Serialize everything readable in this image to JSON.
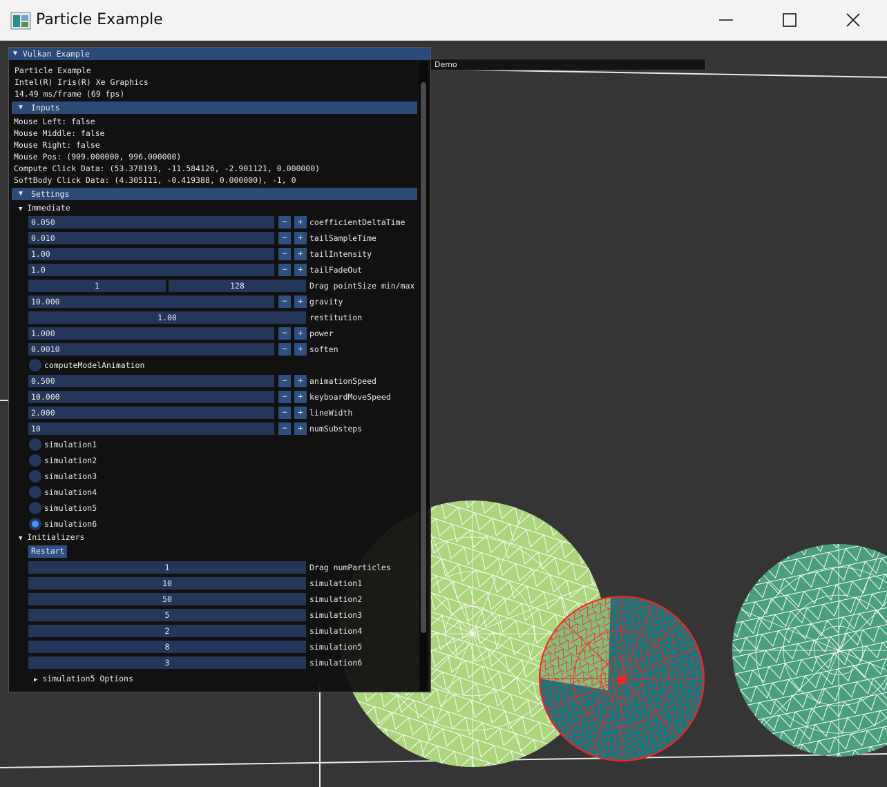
{
  "window": {
    "title": "Particle Example"
  },
  "demo_window": {
    "label": "Demo"
  },
  "panel": {
    "title": "Vulkan Example",
    "info": [
      "Particle Example",
      "Intel(R) Iris(R) Xe Graphics",
      "14.49 ms/frame (69 fps)"
    ],
    "inputs_header": "Inputs",
    "inputs": [
      "Mouse Left: false",
      "Mouse Middle: false",
      "Mouse Right: false",
      "Mouse Pos: (909.000000, 996.000000)",
      "Compute Click Data: (53.378193, -11.584126, -2.901121, 0.000000)",
      "SoftBody Click Data: (4.305111, -0.419388, 0.000000), -1, 0"
    ],
    "settings_header": "Settings",
    "immediate_label": "Immediate",
    "controls": {
      "coefficientDeltaTime": {
        "value": "0.050",
        "label": "coefficientDeltaTime"
      },
      "tailSampleTime": {
        "value": "0.010",
        "label": "tailSampleTime"
      },
      "tailIntensity": {
        "value": "1.00",
        "label": "tailIntensity"
      },
      "tailFadeOut": {
        "value": "1.0",
        "label": "tailFadeOut"
      },
      "pointSize": {
        "min": "1",
        "max": "128",
        "label": "Drag pointSize min/max"
      },
      "gravity": {
        "value": "10.000",
        "label": "gravity"
      },
      "restitution": {
        "value": "1.00",
        "label": "restitution"
      },
      "power": {
        "value": "1.000",
        "label": "power"
      },
      "soften": {
        "value": "0.0010",
        "label": "soften"
      },
      "computeModelAnimation": {
        "label": "computeModelAnimation"
      },
      "animationSpeed": {
        "value": "0.500",
        "label": "animationSpeed"
      },
      "keyboardMoveSpeed": {
        "value": "10.000",
        "label": "keyboardMoveSpeed"
      },
      "lineWidth": {
        "value": "2.000",
        "label": "lineWidth"
      },
      "numSubsteps": {
        "value": "10",
        "label": "numSubsteps"
      }
    },
    "minus": "−",
    "plus": "+",
    "simulations": [
      {
        "label": "simulation1",
        "selected": false
      },
      {
        "label": "simulation2",
        "selected": false
      },
      {
        "label": "simulation3",
        "selected": false
      },
      {
        "label": "simulation4",
        "selected": false
      },
      {
        "label": "simulation5",
        "selected": false
      },
      {
        "label": "simulation6",
        "selected": true
      }
    ],
    "initializers_label": "Initializers",
    "restart_label": "Restart",
    "init_values": [
      {
        "value": "1",
        "label": "Drag numParticles"
      },
      {
        "value": "10",
        "label": "simulation1"
      },
      {
        "value": "50",
        "label": "simulation2"
      },
      {
        "value": "5",
        "label": "simulation3"
      },
      {
        "value": "2",
        "label": "simulation4"
      },
      {
        "value": "8",
        "label": "simulation5"
      },
      {
        "value": "3",
        "label": "simulation6"
      }
    ],
    "options_label": "simulation5 Options"
  },
  "colors": {
    "panel_header": "#2c4a76",
    "field": "#24375a",
    "button": "#2d4f82",
    "radio_active": "#4296fa",
    "ball_light_green": "#acd57d",
    "ball_teal": "#0f7a80",
    "ball_green": "#4b9f7c",
    "wire_red": "#ff2020"
  },
  "icons": [
    "app-icon",
    "minimize-icon",
    "maximize-icon",
    "close-icon",
    "collapse-arrow-icon",
    "expand-arrow-icon"
  ]
}
